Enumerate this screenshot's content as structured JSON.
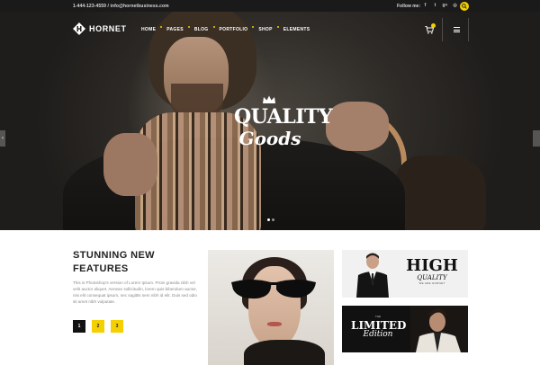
{
  "topbar": {
    "contact": "1-444-123-4559  /  info@hornetbusiness.com",
    "follow_label": "Follow me:",
    "socials": [
      {
        "icon": "facebook-icon",
        "glyph": "f"
      },
      {
        "icon": "twitter-icon",
        "glyph": "t"
      },
      {
        "icon": "google-plus-icon",
        "glyph": "g+"
      },
      {
        "icon": "instagram-icon",
        "glyph": "◎"
      }
    ],
    "search_icon": "search-icon"
  },
  "header": {
    "brand": "HORNET",
    "nav": [
      {
        "label": "HOME"
      },
      {
        "label": "PAGES"
      },
      {
        "label": "BLOG"
      },
      {
        "label": "PORTFOLIO"
      },
      {
        "label": "SHOP"
      },
      {
        "label": "ELEMENTS"
      }
    ],
    "accent_color": "#f5d000"
  },
  "hero": {
    "title_line1": "QUALITY",
    "title_line2": "Goods",
    "prev_glyph": "‹",
    "slides_count": 2,
    "active_slide": 1
  },
  "features": {
    "title": "STUNNING NEW FEATURES",
    "body": "This is Photoshop's version of Lorem Ipsum. Proin gravida nibh vel velit auctor aliquet. Aenean sollicitudin, lorem quis bibendum auctor, nisi elit consequat ipsum, nec sagittis sem nibh id elit. Duis sed odio sit amet nibh vulputate.",
    "pages": [
      "1",
      "2",
      "3"
    ],
    "active_page": "1"
  },
  "cards": {
    "high": {
      "line1": "HIGH",
      "line2": "QUALITY",
      "line3": "WE ARE HORNET"
    },
    "limited": {
      "line1": "THE",
      "line2": "LIMITED",
      "line3": "Edition"
    }
  }
}
